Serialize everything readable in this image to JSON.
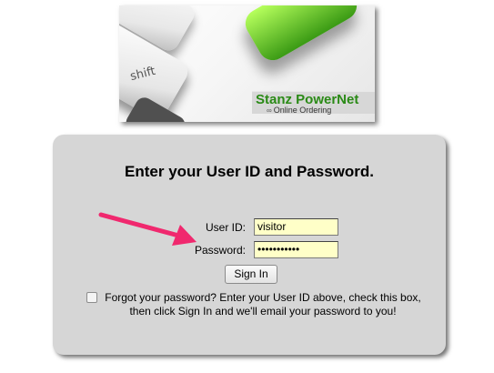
{
  "banner": {
    "key_label": "shift",
    "brand_title": "Stanz PowerNet",
    "brand_subtitle": "Online Ordering",
    "brand_color": "#2a8a16"
  },
  "login": {
    "heading": "Enter your User ID and Password.",
    "user_label": "User ID:",
    "user_value": "visitor",
    "password_label": "Password:",
    "password_value": "•••••••••••",
    "signin_label": "Sign In",
    "forgot_line1": "Forgot your password? Enter your User ID above, check this box,",
    "forgot_line2": "then click Sign In and we'll email your password to you!",
    "forgot_checked": false,
    "field_bg": "#ffffc8",
    "panel_bg": "#d6d6d6"
  },
  "annotation": {
    "arrow_color": "#f0286e"
  }
}
